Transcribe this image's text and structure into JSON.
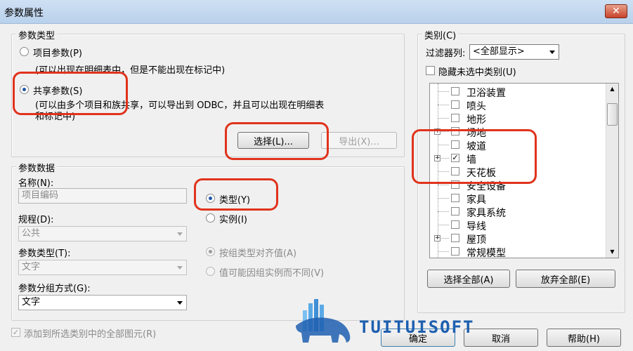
{
  "window": {
    "title": "参数属性",
    "close_glyph": "✕"
  },
  "param_type": {
    "legend": "参数类型",
    "project_label": "项目参数(P)",
    "project_desc": "(可以出现在明细表中，但是不能出现在标记中)",
    "shared_label": "共享参数(S)",
    "shared_desc_line1": "(可以由多个项目和族共享，可以导出到 ODBC，并且可以出现在明细表",
    "shared_desc_line2": "和标记中)",
    "select_button": "选择(L)...",
    "export_button": "导出(X)..."
  },
  "param_data": {
    "legend": "参数数据",
    "name_label": "名称(N):",
    "name_value": "项目编码",
    "discipline_label": "规程(D):",
    "discipline_value": "公共",
    "type_label": "参数类型(T):",
    "type_value": "文字",
    "group_label": "参数分组方式(G):",
    "group_value": "文字",
    "type_radio": "类型(Y)",
    "instance_radio": "实例(I)",
    "align_by_group": "按组类型对齐值(A)",
    "vary_by_group": "值可能因组实例而不同(V)"
  },
  "category": {
    "legend": "类别(C)",
    "filter_label": "过滤器列:",
    "filter_value": "<全部显示>",
    "hide_unchecked": "隐藏未选中类别(U)",
    "items": [
      {
        "label": "卫浴装置",
        "checked": false,
        "expand": false
      },
      {
        "label": "喷头",
        "checked": false,
        "expand": false
      },
      {
        "label": "地形",
        "checked": false,
        "expand": false
      },
      {
        "label": "场地",
        "checked": false,
        "expand": true
      },
      {
        "label": "坡道",
        "checked": false,
        "expand": false
      },
      {
        "label": "墙",
        "checked": true,
        "expand": true
      },
      {
        "label": "天花板",
        "checked": false,
        "expand": false
      },
      {
        "label": "安全设备",
        "checked": false,
        "expand": false
      },
      {
        "label": "家具",
        "checked": false,
        "expand": false
      },
      {
        "label": "家具系统",
        "checked": false,
        "expand": false
      },
      {
        "label": "导线",
        "checked": false,
        "expand": false
      },
      {
        "label": "屋顶",
        "checked": false,
        "expand": true
      },
      {
        "label": "常规模型",
        "checked": false,
        "expand": false
      }
    ],
    "select_all": "选择全部(A)",
    "deselect_all": "放弃全部(E)"
  },
  "footer": {
    "add_to_all": "添加到所选类别中的全部图元(R)",
    "ok": "确定",
    "cancel": "取消",
    "help": "帮助(H)"
  },
  "watermark": {
    "text": "TUITUISOFT"
  },
  "colors": {
    "highlight": "#e0331c",
    "accent": "#1e5fb0"
  }
}
